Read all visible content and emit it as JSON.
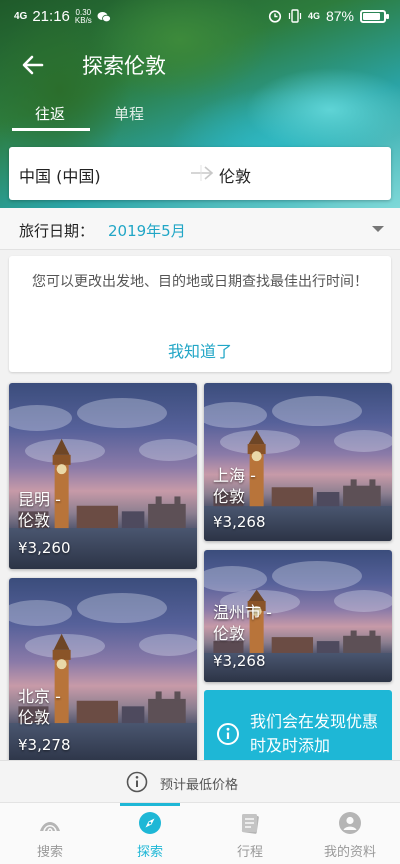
{
  "statusbar": {
    "signal_left": "4G",
    "time": "21:16",
    "speed_value": "0.30",
    "speed_unit": "KB/s",
    "signal_right": "4G",
    "battery": "87%",
    "battery_level": 0.87
  },
  "header": {
    "title": "探索伦敦",
    "tabs": [
      {
        "label": "往返",
        "active": true
      },
      {
        "label": "单程",
        "active": false
      }
    ]
  },
  "route": {
    "origin": "中国 (中国)",
    "destination": "伦敦"
  },
  "date": {
    "label": "旅行日期：",
    "value": "2019年5月"
  },
  "tip": {
    "text": "您可以更改出发地、目的地或日期查找最佳出行时间！",
    "button": "我知道了"
  },
  "deals": [
    {
      "city_line1": "昆明 -",
      "city_line2": "伦敦",
      "price": "¥3,260"
    },
    {
      "city_line1": "上海 -",
      "city_line2": "伦敦",
      "price": "¥3,268"
    },
    {
      "city_line1": "温州市 -",
      "city_line2": "伦敦",
      "price": "¥3,268"
    },
    {
      "city_line1": "北京 -",
      "city_line2": "伦敦",
      "price": "¥3,278"
    }
  ],
  "notify": {
    "text": "我们会在发现优惠时及时添加"
  },
  "estimate": {
    "text": "预计最低价格"
  },
  "nav": {
    "items": [
      {
        "label": "搜索",
        "icon": "search-wifi-icon"
      },
      {
        "label": "探索",
        "icon": "compass-icon"
      },
      {
        "label": "行程",
        "icon": "trips-icon"
      },
      {
        "label": "我的资料",
        "icon": "profile-icon"
      }
    ]
  },
  "colors": {
    "accent": "#1eb7d6",
    "date_value": "#21a6c6"
  }
}
